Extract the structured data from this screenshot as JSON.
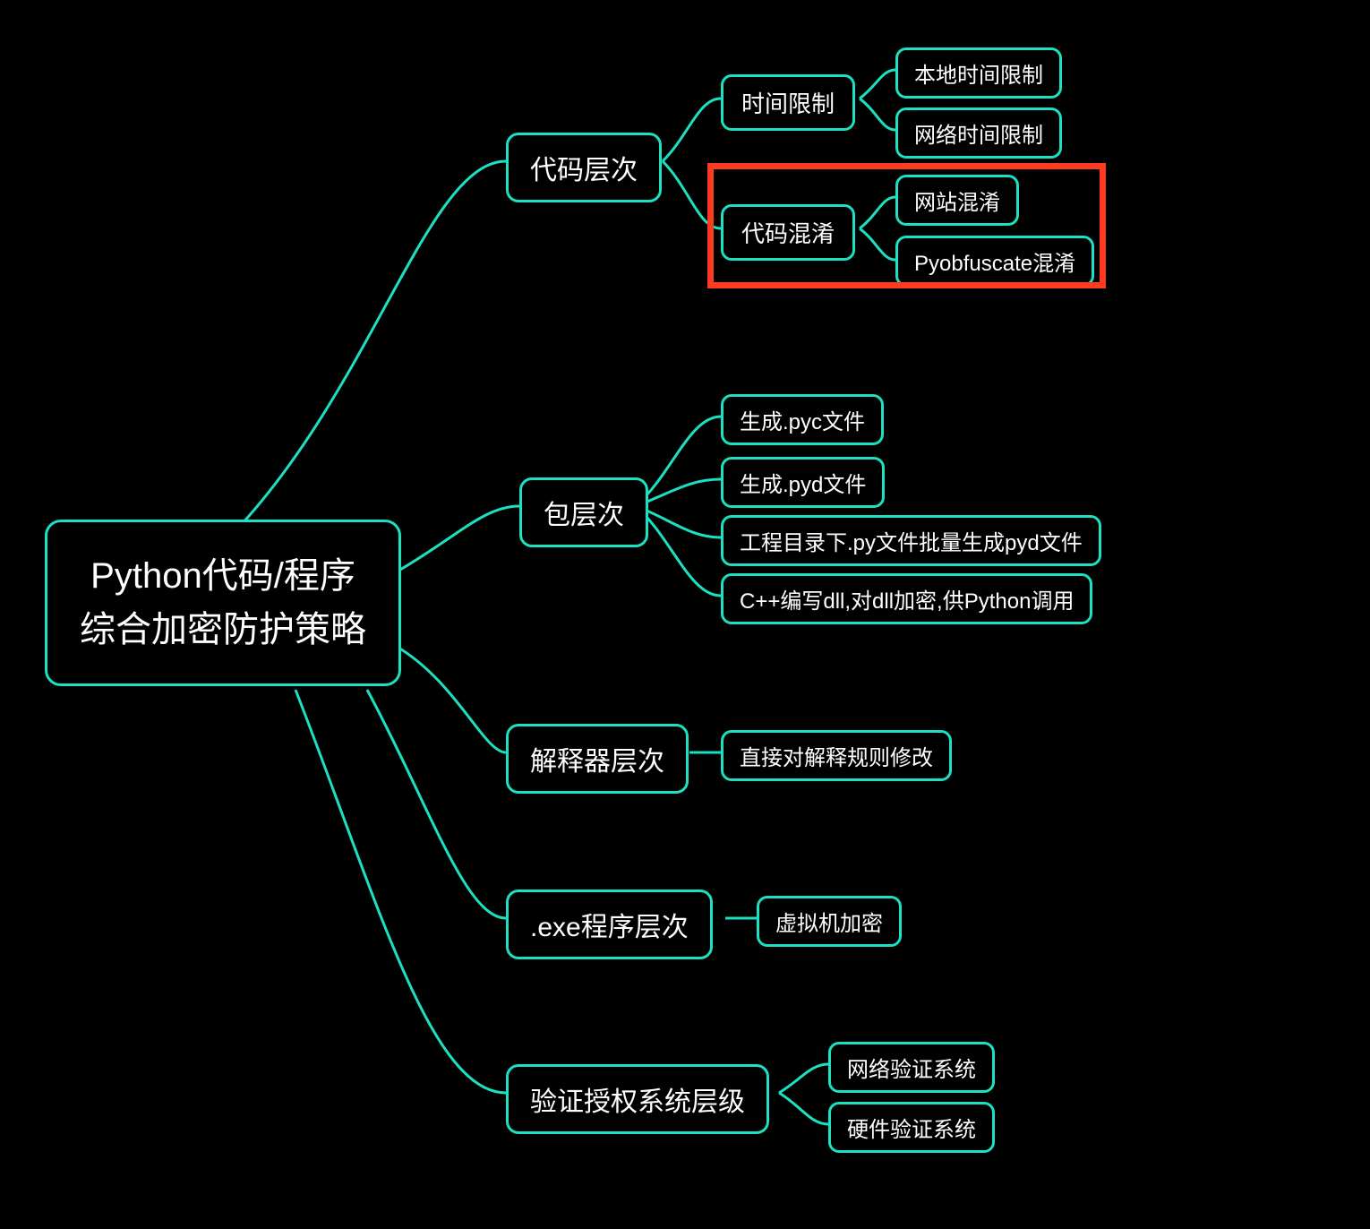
{
  "colors": {
    "border": "#1de0c2",
    "highlight": "#ff3b1f",
    "bg": "#000000",
    "text": "#ffffff"
  },
  "root": {
    "line1": "Python代码/程序",
    "line2": "综合加密防护策略"
  },
  "branches": [
    {
      "label": "代码层次",
      "children": [
        {
          "label": "时间限制",
          "children": [
            {
              "label": "本地时间限制"
            },
            {
              "label": "网络时间限制"
            }
          ]
        },
        {
          "label": "代码混淆",
          "highlighted": true,
          "children": [
            {
              "label": "网站混淆"
            },
            {
              "label": "Pyobfuscate混淆"
            }
          ]
        }
      ]
    },
    {
      "label": "包层次",
      "children": [
        {
          "label": "生成.pyc文件"
        },
        {
          "label": "生成.pyd文件"
        },
        {
          "label": "工程目录下.py文件批量生成pyd文件"
        },
        {
          "label": "C++编写dll,对dll加密,供Python调用"
        }
      ]
    },
    {
      "label": "解释器层次",
      "children": [
        {
          "label": "直接对解释规则修改"
        }
      ]
    },
    {
      "label": ".exe程序层次",
      "children": [
        {
          "label": "虚拟机加密"
        }
      ]
    },
    {
      "label": "验证授权系统层级",
      "children": [
        {
          "label": "网络验证系统"
        },
        {
          "label": "硬件验证系统"
        }
      ]
    }
  ]
}
